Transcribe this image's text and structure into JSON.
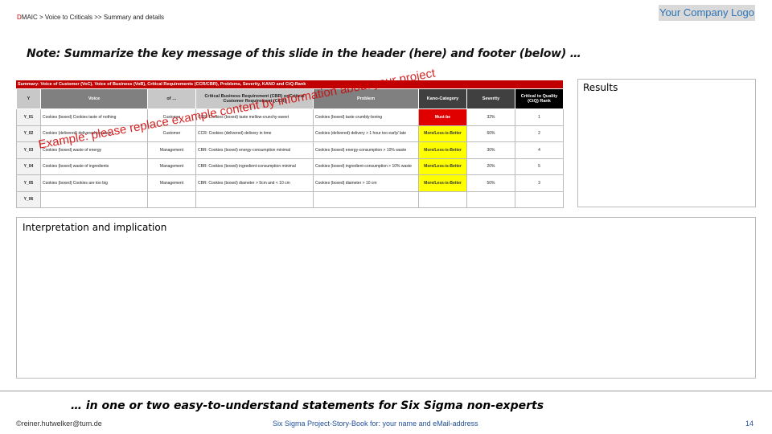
{
  "header": {
    "breadcrumb_d": "D",
    "breadcrumb_rest": "MAIC > Voice to Criticals >> Summary and details",
    "logo": "Your Company Logo",
    "note": "Note: Summarize the key message of this slide in the header (here) and footer (below) …"
  },
  "table": {
    "title": "Summary: Voice of Customer (VoC), Voice of Business (VoB), Critical Requirements (CCR/CBR), Problems, Severity, KANO and CtQ-Rank",
    "headers": [
      "Y",
      "Voice",
      "of …",
      "Critical Business Requirement (CBR) or Critical Customer Requirement (CCR)",
      "Problem",
      "Kano-Category",
      "Severity",
      "Critical to Quality (CtQ) Rank"
    ],
    "rows": [
      [
        "Y_01",
        "Cookies (boxed) Cookies taste of nothing",
        "Customer",
        "CCR: Cookies (boxed) taste mellow-crunchy-sweet",
        "Cookies (boxed) taste crumbly-boring",
        "Must-be",
        "32%",
        "1"
      ],
      [
        "Y_02",
        "Cookies (delivered) delivered too early",
        "Customer",
        "CCR: Cookies (delivered) delivery in time",
        "Cookies (delivered) delivery > 1 hour too early/ late",
        "More/Less-is-Better",
        "60%",
        "2"
      ],
      [
        "Y_03",
        "Cookies (boxed) waste of energy",
        "Management",
        "CBR: Cookies (boxed) energy-consumption minimal",
        "Cookies (boxed) energy-consumption > 10% waste",
        "More/Less-is-Better",
        "30%",
        "4"
      ],
      [
        "Y_04",
        "Cookies (boxed) waste of ingredients",
        "Management",
        "CBR: Cookies (boxed) ingredient-consumption minimal",
        "Cookies (boxed) ingredient-consumption > 10% waste",
        "More/Less-is-Better",
        "20%",
        "5"
      ],
      [
        "Y_05",
        "Cookies (boxed) Cookies are too big",
        "Management",
        "CBR: Cookies (boxed) diameter > 9cm and < 10 cm",
        "Cookies (boxed) diameter > 10 cm",
        "More/Less-is-Better",
        "50%",
        "3"
      ],
      [
        "Y_06",
        "",
        "",
        "",
        "",
        "",
        "",
        ""
      ]
    ],
    "kano_colors": {
      "Must-be": "#e00000",
      "More/Less-is-Better": "#ffff00"
    },
    "watermark": "Example: please replace example content by information about your project"
  },
  "results": {
    "label": "Results"
  },
  "interpretation": {
    "label": "Interpretation and implication"
  },
  "footer": {
    "message": "… in one or two easy-to-understand statements for Six Sigma non-experts",
    "author": "©reiner.hutwelker@tum.de",
    "center": "Six Sigma Project-Story-Book for: your name and eMail-address",
    "page": "14"
  }
}
